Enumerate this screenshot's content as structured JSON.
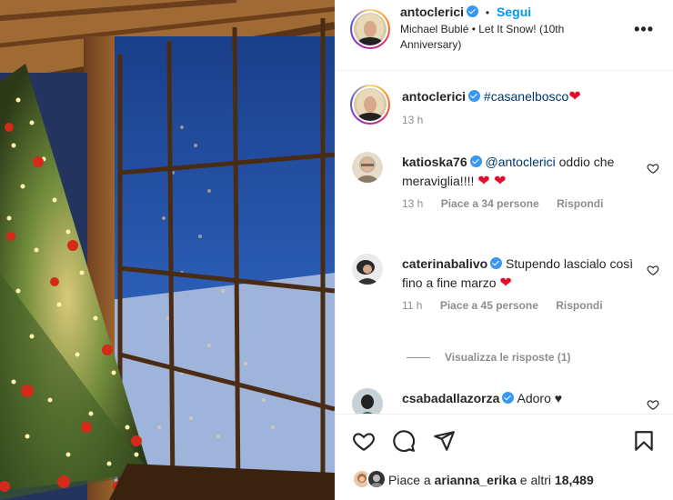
{
  "post": {
    "author": "antoclerici",
    "follow_label": "Segui",
    "separator": "•",
    "music": "Michael Bublé • Let It Snow! (10th Anniversary)"
  },
  "caption": {
    "author": "antoclerici",
    "hashtag": "#casanelbosco",
    "emoji": "❤",
    "time": "13 h"
  },
  "comments": [
    {
      "author": "katioska76",
      "mention": "@antoclerici",
      "text": " oddio che meraviglia!!!!",
      "emoji": "❤ ❤",
      "time": "13 h",
      "likes": "Piace a 34 persone",
      "reply": "Rispondi"
    },
    {
      "author": "caterinabalivo",
      "text": " Stupendo lascialo così fino a fine marzo",
      "emoji": "❤",
      "time": "11 h",
      "likes": "Piace a 45 persone",
      "reply": "Rispondi"
    },
    {
      "author": "csabadallazorza",
      "text": " Adoro ♥"
    }
  ],
  "view_replies": "Visualizza le risposte (1)",
  "likes_summary": {
    "prefix": "Piace a ",
    "user": "arianna_erika",
    "suffix": " e altri ",
    "count": "18,489"
  },
  "icons": {
    "more": "more-options-icon",
    "like": "heart-icon",
    "comment": "comment-icon",
    "share": "share-icon",
    "save": "bookmark-icon",
    "verified": "verified-badge-icon"
  },
  "colors": {
    "link": "#0095f6",
    "verified": "#3897f0",
    "mention": "#00376b",
    "heart": "#e0102c",
    "muted": "#8e8e8e"
  }
}
